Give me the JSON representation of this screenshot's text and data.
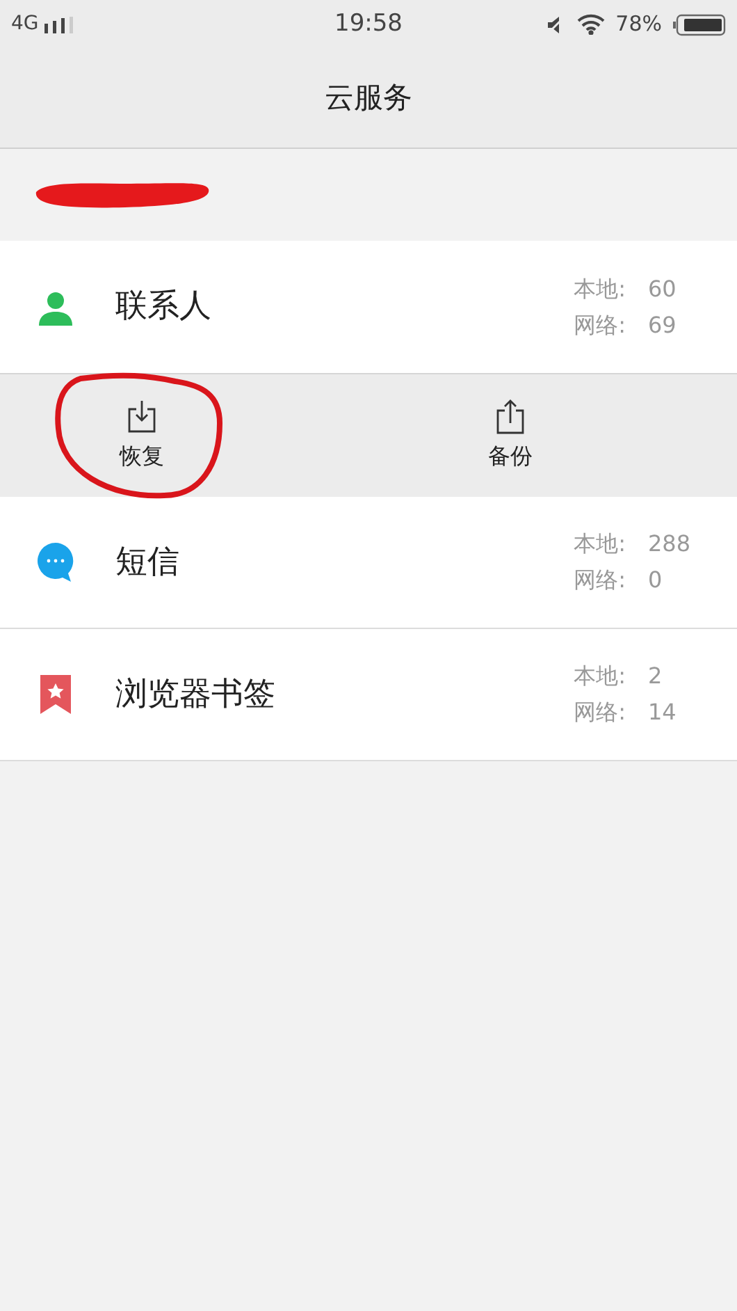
{
  "status_bar": {
    "network": "4G",
    "time": "19:58",
    "battery": "78%"
  },
  "title": "云服务",
  "account": {
    "redacted": true
  },
  "items": [
    {
      "kind": "contacts",
      "name": "联系人",
      "expanded": true,
      "stats": [
        {
          "label": "本地:",
          "value": "60"
        },
        {
          "label": "网络:",
          "value": "69"
        }
      ],
      "actions": [
        {
          "kind": "restore",
          "label": "恢复",
          "circled": true
        },
        {
          "kind": "backup",
          "label": "备份",
          "circled": false
        }
      ]
    },
    {
      "kind": "messages",
      "name": "短信",
      "expanded": false,
      "stats": [
        {
          "label": "本地:",
          "value": "288"
        },
        {
          "label": "网络:",
          "value": "0"
        }
      ]
    },
    {
      "kind": "bookmarks",
      "name": "浏览器书签",
      "expanded": false,
      "stats": [
        {
          "label": "本地:",
          "value": "2"
        },
        {
          "label": "网络:",
          "value": "14"
        }
      ]
    }
  ]
}
